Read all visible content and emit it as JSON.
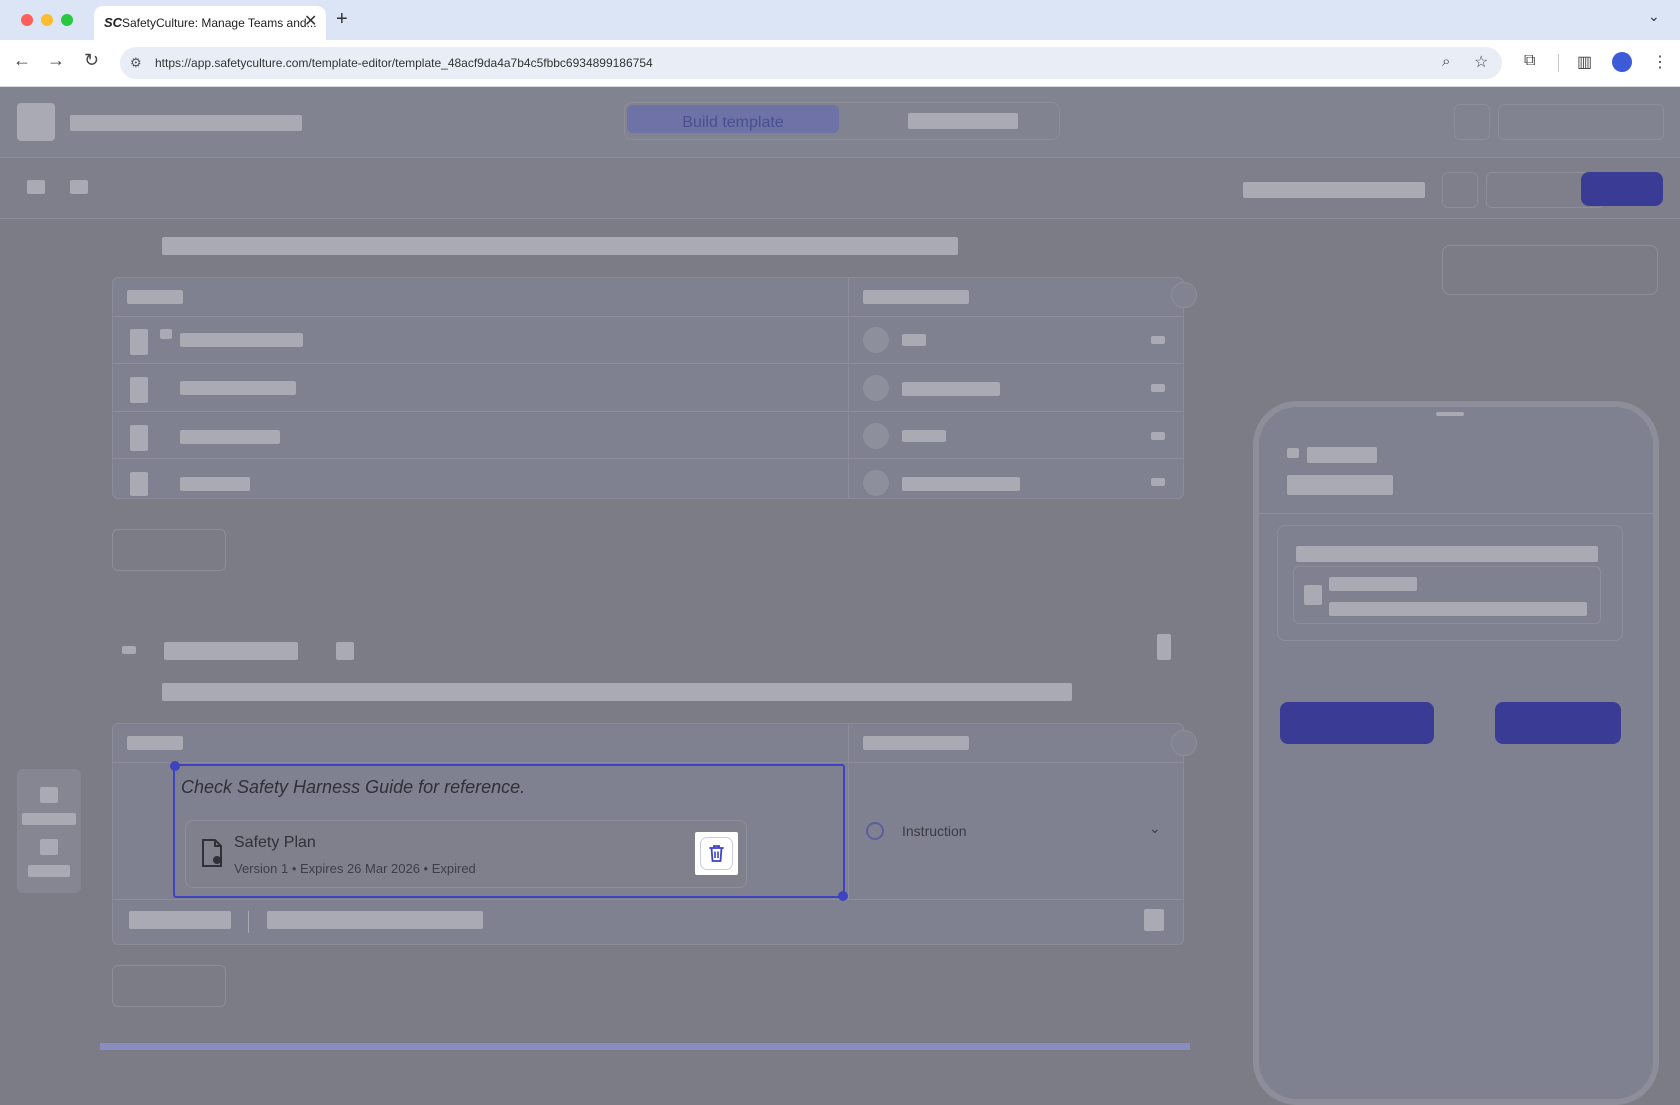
{
  "browser": {
    "tab_logo": "SC",
    "tab_title": "SafetyCulture: Manage Teams and...",
    "close_glyph": "✕",
    "new_tab_glyph": "+",
    "tab_menu_glyph": "⌄",
    "url": "https://app.safetyculture.com/template-editor/template_48acf9da4a7b4c5fbbc6934899186754",
    "icons": [
      "back-icon",
      "forward-icon",
      "reload-icon",
      "site-settings-icon",
      "zoom-icon",
      "bookmark-star-icon",
      "extensions-icon",
      "side-panel-icon",
      "profile-icon",
      "more-icon"
    ]
  },
  "editor": {
    "mode_tab_label": "Build template",
    "question": {
      "text": "Check Safety Harness Guide for reference.",
      "document": {
        "name": "Safety Plan",
        "meta": "Version 1  •  Expires 26 Mar 2026  •  Expired"
      },
      "response_type": "Instruction"
    }
  },
  "colors": {
    "accent": "#3f43c2",
    "overlay": "#7b7c85",
    "primary_button": "#3a3b95"
  }
}
